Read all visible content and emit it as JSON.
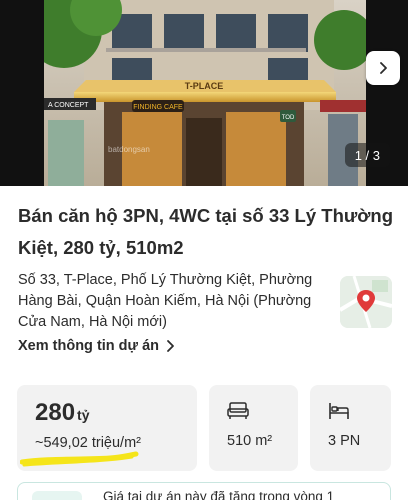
{
  "gallery": {
    "counter": "1 / 3",
    "signs": {
      "building": "T-PLACE",
      "cafe": "FINDING CAFE",
      "concept": "A CONCEPT",
      "tod": "TOD",
      "watermark": "batdongsan"
    }
  },
  "listing": {
    "title": "Bán căn hộ 3PN, 4WC tại số 33 Lý Thường Kiệt, 280 tỷ, 510m2",
    "address": "Số 33, T-Place, Phố Lý Thường Kiệt, Phường Hàng Bài, Quận Hoàn Kiếm, Hà Nội (Phường Cửa Nam, Hà Nội mới)",
    "project_link": "Xem thông tin dự án"
  },
  "stats": {
    "price_value": "280",
    "price_unit": "tỷ",
    "price_per_m2": "~549,02 triệu/m²",
    "area": "510 m²",
    "bedrooms": "3 PN"
  },
  "promo": {
    "text": "Giá tại dự án này đã tăng trong vòng 1"
  },
  "colors": {
    "highlight": "#f5e51a",
    "pin": "#e03a3a",
    "text": "#2c2c2c",
    "card_bg": "#f2f2f2"
  },
  "icons": {
    "next": "chevron-right-icon",
    "link": "chevron-right-icon",
    "area": "sofa-icon",
    "bed": "bed-icon",
    "map": "map-pin-icon"
  }
}
